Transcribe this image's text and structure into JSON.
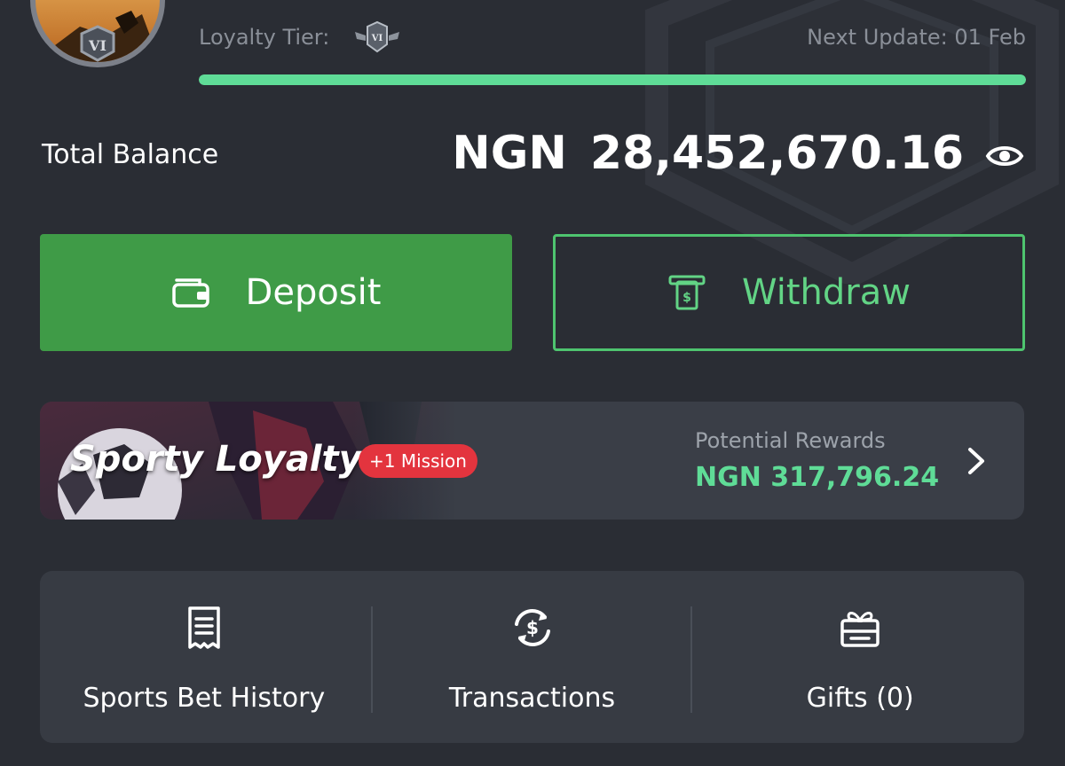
{
  "header": {
    "avatar_badge": "VI",
    "loyalty_tier_label": "Loyalty Tier:",
    "tier_badge_text": "VI",
    "next_update": "Next Update: 01 Feb",
    "progress_fraction": 1.0,
    "accent_color": "#5fdc97"
  },
  "balance": {
    "label": "Total Balance",
    "currency": "NGN",
    "amount": "28,452,670.16",
    "visibility_icon": "eye-icon"
  },
  "actions": {
    "deposit": {
      "label": "Deposit",
      "icon": "wallet-icon",
      "color": "#3f9b47"
    },
    "withdraw": {
      "label": "Withdraw",
      "icon": "atm-cash-icon",
      "color": "#62d485"
    }
  },
  "loyalty": {
    "title": "Sporty Loyalty",
    "mission_badge": "+1 Mission",
    "rewards_label": "Potential Rewards",
    "rewards_value": "NGN 317,796.24",
    "badge_color": "#e3343e"
  },
  "quick_links": [
    {
      "label": "Sports Bet History",
      "icon": "receipt-icon"
    },
    {
      "label": "Transactions",
      "icon": "currency-exchange-icon"
    },
    {
      "label": "Gifts (0)",
      "icon": "gift-icon"
    }
  ]
}
